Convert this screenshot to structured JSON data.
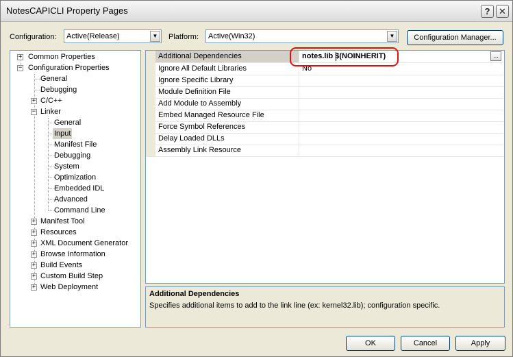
{
  "window": {
    "title": "NotesCAPICLI Property Pages",
    "help_label": "?",
    "close_label": "✕"
  },
  "config_bar": {
    "configuration_label": "Configuration:",
    "configuration_value": "Active(Release)",
    "platform_label": "Platform:",
    "platform_value": "Active(Win32)",
    "manager_button": "Configuration Manager..."
  },
  "tree": {
    "common_properties": "Common Properties",
    "configuration_properties": "Configuration Properties",
    "general": "General",
    "debugging": "Debugging",
    "cpp": "C/C++",
    "linker": "Linker",
    "linker_children": [
      "General",
      "Input",
      "Manifest File",
      "Debugging",
      "System",
      "Optimization",
      "Embedded IDL",
      "Advanced",
      "Command Line"
    ],
    "tail_items": [
      "Manifest Tool",
      "Resources",
      "XML Document Generator",
      "Browse Information",
      "Build Events",
      "Custom Build Step",
      "Web Deployment"
    ]
  },
  "grid": {
    "rows": [
      {
        "name": "Additional Dependencies",
        "value": "notes.lib $(NOINHERIT)"
      },
      {
        "name": "Ignore All Default Libraries",
        "value": "No"
      },
      {
        "name": "Ignore Specific Library",
        "value": ""
      },
      {
        "name": "Module Definition File",
        "value": ""
      },
      {
        "name": "Add Module to Assembly",
        "value": ""
      },
      {
        "name": "Embed Managed Resource File",
        "value": ""
      },
      {
        "name": "Force Symbol References",
        "value": ""
      },
      {
        "name": "Delay Loaded DLLs",
        "value": ""
      },
      {
        "name": "Assembly Link Resource",
        "value": ""
      }
    ],
    "ellipsis_label": "..."
  },
  "description": {
    "title": "Additional Dependencies",
    "text": "Specifies additional items to add to the link line (ex: kernel32.lib); configuration specific."
  },
  "buttons": {
    "ok": "OK",
    "cancel": "Cancel",
    "apply": "Apply"
  },
  "colors": {
    "highlight_ring": "#e01010",
    "dialog_bg": "#ece9d8",
    "selection_bg": "#d4d0c8"
  }
}
